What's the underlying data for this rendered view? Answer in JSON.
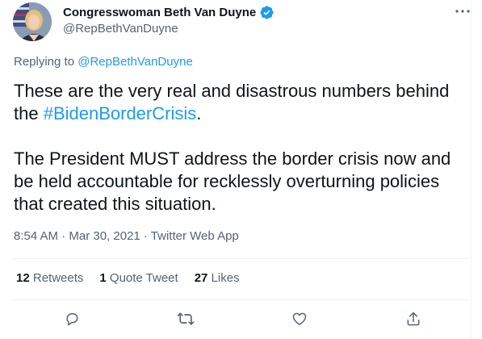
{
  "tweet": {
    "display_name": "Congresswoman Beth Van Duyne",
    "handle": "@RepBethVanDuyne",
    "replying_prefix": "Replying to",
    "replying_to": "@RepBethVanDuyne",
    "text_line1_pre": "These are the very real and disastrous numbers behind the ",
    "hashtag": "#BidenBorderCrisis",
    "text_line1_post": ".",
    "text_para2": "The President MUST address the border crisis now and be held accountable for recklessly overturning policies that created this situation.",
    "timestamp": "8:54 AM · Mar 30, 2021 · Twitter Web App"
  },
  "stats": {
    "retweets_count": "12",
    "retweets_label": "Retweets",
    "quotes_count": "1",
    "quotes_label": "Quote Tweet",
    "likes_count": "27",
    "likes_label": "Likes"
  },
  "colors": {
    "accent": "#1d9bf0",
    "secondary_text": "#536471",
    "primary_text": "#0f1419"
  },
  "icons": [
    "verified-badge-icon",
    "more-icon",
    "reply-icon",
    "retweet-icon",
    "like-icon",
    "share-icon"
  ]
}
